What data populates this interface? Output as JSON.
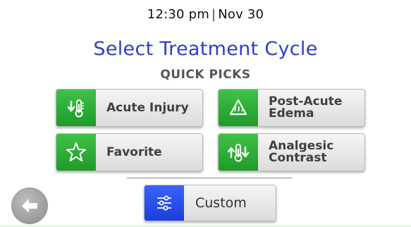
{
  "header": {
    "time": "12:30 pm",
    "separator": "|",
    "date": "Nov 30"
  },
  "title": "Select Treatment Cycle",
  "subtitle": "QUICK PICKS",
  "quick_picks": [
    {
      "label": "Acute Injury",
      "icon": "thermometer-down-icon"
    },
    {
      "label": "Post-Acute\nEdema",
      "icon": "edema-triangle-icon"
    },
    {
      "label": "Favorite",
      "icon": "star-icon"
    },
    {
      "label": "Analgesic\nContrast",
      "icon": "thermometer-updown-icon"
    }
  ],
  "custom": {
    "label": "Custom",
    "icon": "sliders-icon"
  },
  "back": {
    "icon": "back-arrow-icon"
  },
  "colors": {
    "title": "#2f3fc4",
    "green_accent": "#2fae38",
    "blue_accent": "#2b4ff0"
  }
}
